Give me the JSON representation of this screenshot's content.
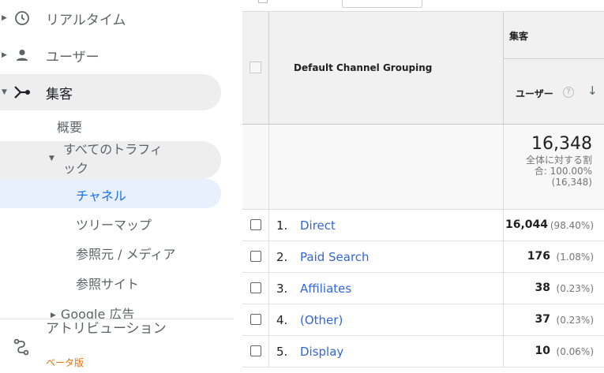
{
  "sidebar": {
    "items": [
      {
        "label": "リアルタイム",
        "icon": "clock-icon"
      },
      {
        "label": "ユーザー",
        "icon": "person-icon"
      },
      {
        "label": "集客",
        "icon": "acquisition-icon"
      }
    ],
    "acquisition_sub": {
      "overview": "概要",
      "all_traffic": "すべてのトラフィック",
      "channels": "チャネル",
      "treemaps": "ツリーマップ",
      "source_medium": "参照元 / メディア",
      "referrals": "参照サイト",
      "google_ads": "Google 広告"
    },
    "attribution": {
      "label": "アトリビューション",
      "badge": "ベータ版"
    }
  },
  "table": {
    "dimension_header": "Default Channel Grouping",
    "group_header": "集客",
    "metric_header": "ユーザー",
    "help_glyph": "?",
    "sort_glyph": "↓",
    "total": {
      "value": "16,348",
      "pct_label": "全体に対する割合: 100.00% (16,348)"
    },
    "rows": [
      {
        "index": "1.",
        "name": "Direct",
        "value": "16,044",
        "pct": "(98.40%)"
      },
      {
        "index": "2.",
        "name": "Paid Search",
        "value": "176",
        "pct": "(1.08%)"
      },
      {
        "index": "3.",
        "name": "Affiliates",
        "value": "38",
        "pct": "(0.23%)"
      },
      {
        "index": "4.",
        "name": "(Other)",
        "value": "37",
        "pct": "(0.23%)"
      },
      {
        "index": "5.",
        "name": "Display",
        "value": "10",
        "pct": "(0.06%)"
      }
    ]
  },
  "colors": {
    "link": "#3367d6",
    "active_bg": "#e8f0fe",
    "active_text": "#1a73e8",
    "beta": "#e8710a"
  }
}
